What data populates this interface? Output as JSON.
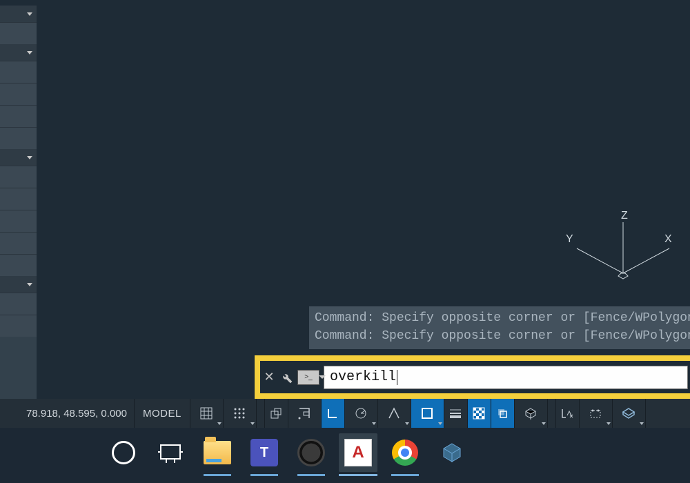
{
  "ucs": {
    "x_label": "X",
    "y_label": "Y",
    "z_label": "Z"
  },
  "command_history": {
    "line1": "Command: Specify opposite corner or [Fence/WPolygon/CPolyg",
    "line2": "Command: Specify opposite corner or [Fence/WPolygon/CPolyg"
  },
  "command_input": {
    "value": "overkill",
    "prompt_badge": ">_"
  },
  "status": {
    "coords": "78.918, 48.595, 0.000",
    "model_label": "MODEL"
  },
  "taskbar": {
    "autocad_letter": "A",
    "teams_letter": "T"
  }
}
